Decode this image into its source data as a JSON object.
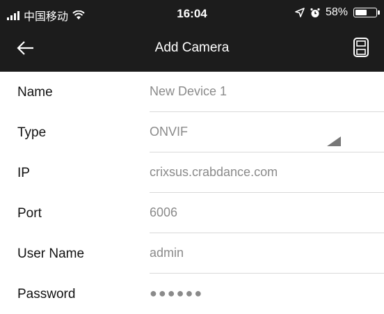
{
  "status_bar": {
    "carrier": "中国移动",
    "time": "16:04",
    "battery_percent": "58%",
    "battery_level": 0.58,
    "icons": [
      "signal-icon",
      "wifi-icon",
      "location-icon",
      "alarm-icon",
      "battery-icon"
    ]
  },
  "nav": {
    "title": "Add Camera",
    "back_icon": "back-arrow-icon",
    "save_icon": "save-icon"
  },
  "form": {
    "name": {
      "label": "Name",
      "value": "New Device 1"
    },
    "type": {
      "label": "Type",
      "value": "ONVIF"
    },
    "ip": {
      "label": "IP",
      "value": "crixsus.crabdance.com"
    },
    "port": {
      "label": "Port",
      "value": "6006"
    },
    "username": {
      "label": "User Name",
      "value": "admin"
    },
    "password": {
      "label": "Password",
      "value": "●●●●●●"
    }
  },
  "colors": {
    "header_bg": "#1c1c1c",
    "label_text": "#111111",
    "value_text": "#8a8a8a",
    "divider": "#d9d9d9"
  }
}
